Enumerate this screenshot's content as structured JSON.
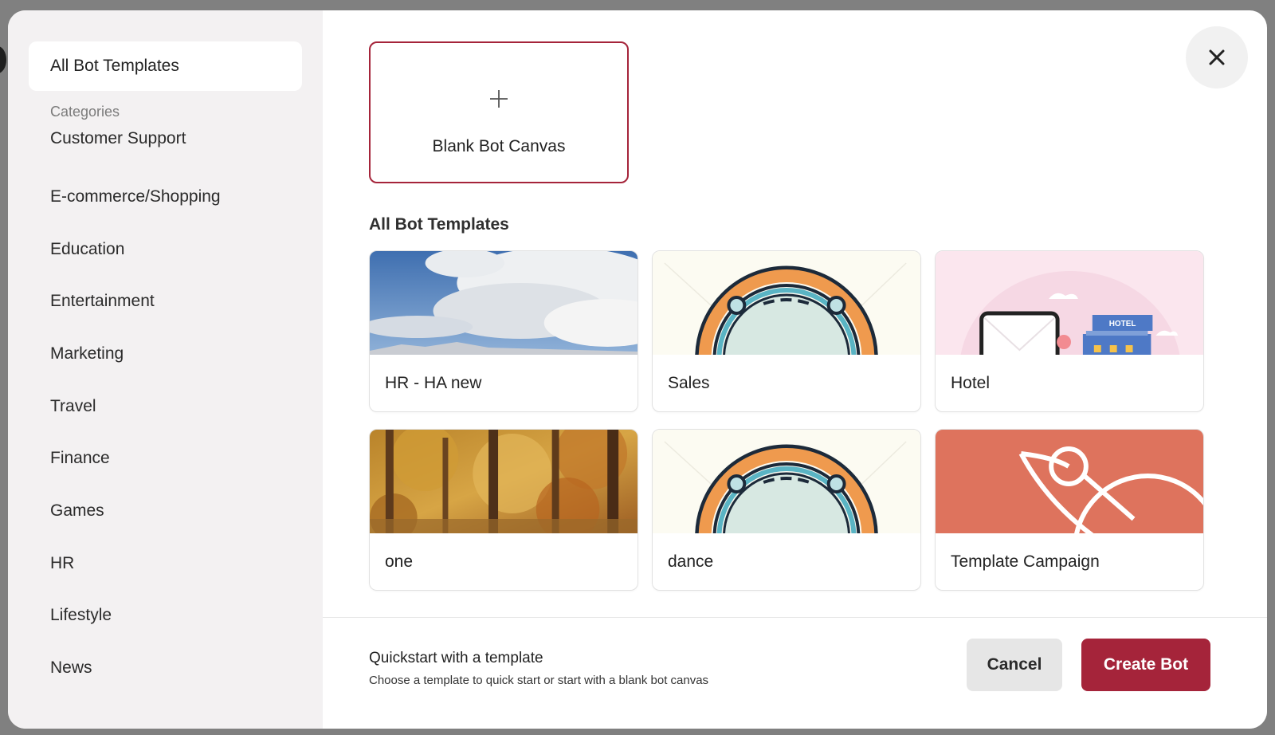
{
  "sidebar": {
    "all_label": "All Bot Templates",
    "categories_heading": "Categories",
    "categories": [
      "Customer Support",
      "E-commerce/Shopping",
      "Education",
      "Entertainment",
      "Marketing",
      "Travel",
      "Finance",
      "Games",
      "HR",
      "Lifestyle",
      "News"
    ]
  },
  "main": {
    "blank_canvas_label": "Blank Bot Canvas",
    "section_title": "All Bot Templates",
    "templates": [
      {
        "name": "HR - HA new",
        "thumb": "sky-clouds"
      },
      {
        "name": "Sales",
        "thumb": "arch-illustration"
      },
      {
        "name": "Hotel",
        "thumb": "hotel-illustration"
      },
      {
        "name": "one",
        "thumb": "autumn-forest"
      },
      {
        "name": "dance",
        "thumb": "arch-illustration"
      },
      {
        "name": "Template Campaign",
        "thumb": "planet-illustration"
      }
    ],
    "hotel_sign": "HOTEL"
  },
  "footer": {
    "title": "Quickstart with a template",
    "subtitle": "Choose a template to quick start or start with a blank bot canvas",
    "cancel_label": "Cancel",
    "create_label": "Create Bot"
  },
  "colors": {
    "accent": "#a5243a",
    "sidebar_bg": "#f3f1f2",
    "campaign_bg": "#de735d"
  },
  "icons": {
    "close": "close-icon",
    "add": "plus-icon"
  }
}
